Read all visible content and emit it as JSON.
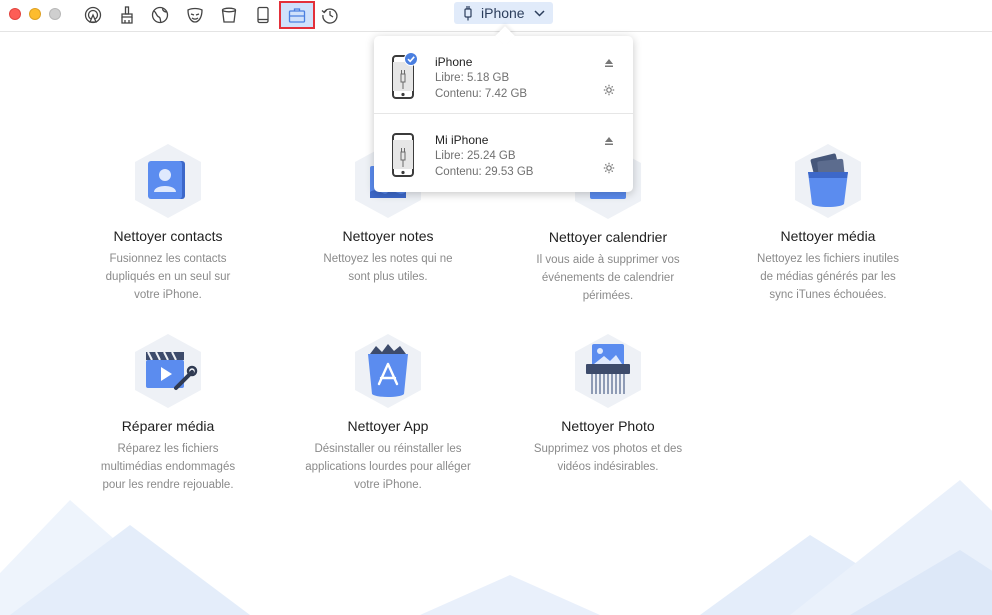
{
  "toolbar": {
    "tools": [
      "airplay-icon",
      "brush-icon",
      "globe-icon",
      "mask-icon",
      "trash-bin-icon",
      "tablet-icon",
      "toolbox-icon",
      "history-icon"
    ],
    "active_tool": "toolbox-icon",
    "device_select": {
      "label": "iPhone"
    }
  },
  "device_popover": {
    "devices": [
      {
        "name": "iPhone",
        "free": "Libre: 5.18 GB",
        "content": "Contenu: 7.42 GB",
        "selected": true
      },
      {
        "name": "Mi iPhone",
        "free": "Libre: 25.24 GB",
        "content": "Contenu: 29.53 GB",
        "selected": false
      }
    ]
  },
  "features": [
    {
      "title": "Nettoyer contacts",
      "desc": [
        "Fusionnez les contacts",
        "dupliqués en un seul sur",
        "votre iPhone."
      ],
      "icon": "contacts-icon"
    },
    {
      "title": "Nettoyer notes",
      "desc": [
        "Nettoyez les notes qui ne",
        "sont plus utiles."
      ],
      "icon": "notes-icon"
    },
    {
      "title": "Nettoyer calendrier",
      "desc": [
        "Il vous aide à supprimer vos",
        "événements de calendrier",
        "périmées."
      ],
      "icon": "calendar-icon"
    },
    {
      "title": "Nettoyer média",
      "desc": [
        "Nettoyez les fichiers inutiles",
        "de médias générés par les",
        "sync iTunes échouées."
      ],
      "icon": "media-bin-icon"
    },
    {
      "title": "Réparer média",
      "desc": [
        "Réparez les fichiers",
        "multimédias endommagés",
        "pour les rendre rejouable."
      ],
      "icon": "repair-media-icon"
    },
    {
      "title": "Nettoyer App",
      "desc": [
        "Désinstaller ou réinstaller les",
        "applications lourdes pour alléger",
        "votre iPhone."
      ],
      "icon": "app-bin-icon"
    },
    {
      "title": "Nettoyer Photo",
      "desc": [
        "Supprimez vos photos et des",
        "vidéos indésirables."
      ],
      "icon": "photo-shredder-icon"
    }
  ],
  "colors": {
    "accent": "#4a7fe0",
    "active_tool_bg": "#cfe1fb",
    "highlight_border": "#e3303a",
    "hex_bg": "#eef1f6",
    "mountain_light": "#eaf1fb"
  }
}
